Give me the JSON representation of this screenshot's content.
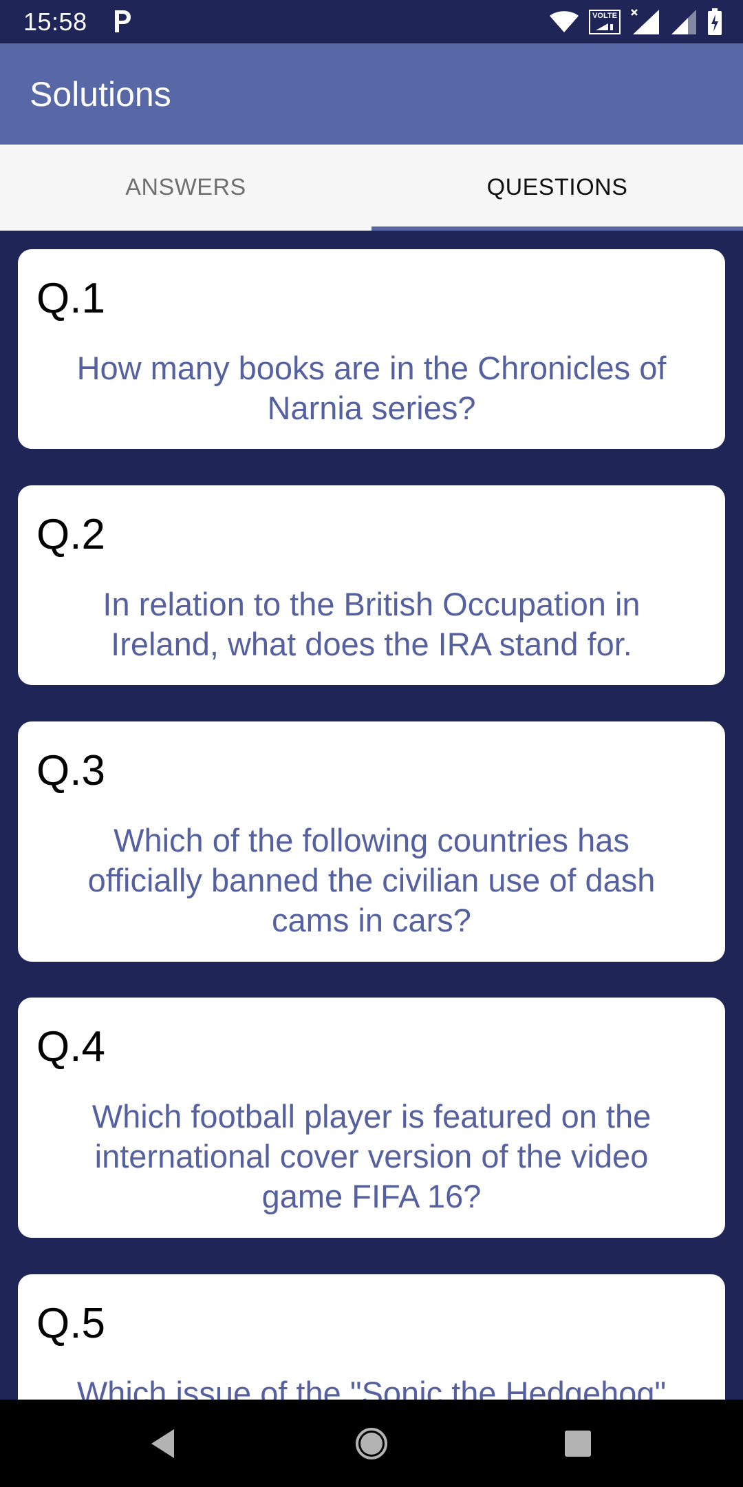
{
  "status_bar": {
    "time": "15:58",
    "network_badge": "VOLTE",
    "icons": [
      "parking-icon",
      "wifi-icon",
      "volte-icon",
      "signal-no-service-icon",
      "signal-icon",
      "battery-charging-icon"
    ]
  },
  "app_bar": {
    "title": "Solutions"
  },
  "tabs": [
    {
      "label": "ANSWERS",
      "selected": false
    },
    {
      "label": "QUESTIONS",
      "selected": true
    }
  ],
  "questions": [
    {
      "number": "Q.1",
      "text": "How many books are in the Chronicles of Narnia series?"
    },
    {
      "number": "Q.2",
      "text": "In relation to the British Occupation in Ireland, what does the IRA stand for."
    },
    {
      "number": "Q.3",
      "text": "Which of the following countries has officially banned the civilian use of dash cams in cars?"
    },
    {
      "number": "Q.4",
      "text": "Which football player is featured on the international cover version of the video game FIFA 16?"
    },
    {
      "number": "Q.5",
      "text": "Which issue of the \"Sonic the Hedgehog\""
    }
  ],
  "nav_bar": {
    "icons": [
      "back-icon",
      "home-icon",
      "recents-icon"
    ]
  },
  "colors": {
    "background": "#1f2657",
    "app_bar": "#5867a6",
    "tab_bar": "#f7f7f7",
    "question_text": "#5560a0",
    "card": "#ffffff"
  }
}
